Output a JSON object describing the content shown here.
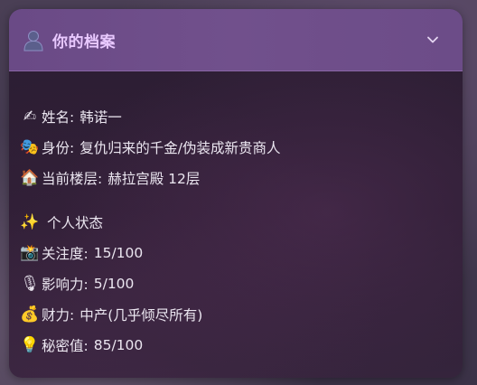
{
  "panel": {
    "title": "你的档案",
    "icons": {
      "avatar": "person-silhouette-icon",
      "toggle": "chevron-down-icon"
    }
  },
  "profile": {
    "name": {
      "icon": "✍",
      "icon_name": "writing-hand-icon",
      "label": "姓名:",
      "value": "韩诺一"
    },
    "identity": {
      "icon": "🎭",
      "icon_name": "theater-masks-icon",
      "label": "身份:",
      "value": "复仇归来的千金/伪装成新贵商人"
    },
    "floor": {
      "icon": "🏠",
      "icon_name": "house-icon",
      "label": "当前楼层:",
      "value": "赫拉宫殿 12层"
    }
  },
  "status": {
    "heading": "个人状态",
    "heading_icon": "✨",
    "heading_icon_name": "sparkles-icon",
    "items": [
      {
        "icon": "📸",
        "icon_name": "camera-flash-icon",
        "label": "关注度:",
        "value": "15/100"
      },
      {
        "icon": "🎙",
        "icon_name": "microphone-icon",
        "label": "影响力:",
        "value": "5/100"
      },
      {
        "icon": "💰",
        "icon_name": "money-bag-icon",
        "label": "财力:",
        "value": "中产(几乎倾尽所有)"
      },
      {
        "icon": "💡",
        "icon_name": "light-bulb-icon",
        "label": "秘密值:",
        "value": "85/100"
      }
    ]
  },
  "colors": {
    "header_bg": "#6c4c88",
    "title_text": "#e9c9ff",
    "card_bg": "#2c1e33",
    "body_text": "#ebe6f0"
  }
}
